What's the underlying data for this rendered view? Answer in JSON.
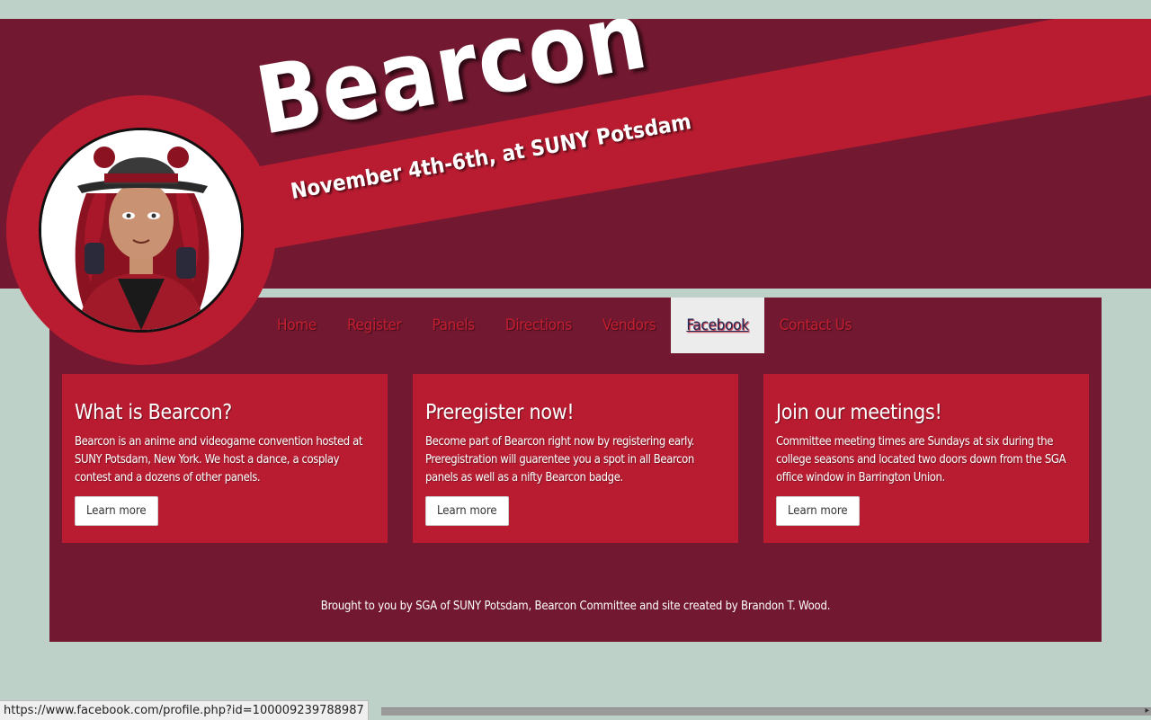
{
  "site": {
    "title": "Bearcon",
    "subtitle": "November 4th-6th, at SUNY Potsdam"
  },
  "colors": {
    "page_bg": "#bdd1c8",
    "dark_red": "#721830",
    "bright_red": "#b91c31",
    "nav_text": "#c41f30"
  },
  "nav": {
    "items": [
      {
        "label": "Home"
      },
      {
        "label": "Register"
      },
      {
        "label": "Panels"
      },
      {
        "label": "Directions"
      },
      {
        "label": "Vendors"
      },
      {
        "label": "Facebook",
        "active": true
      },
      {
        "label": "Contact Us"
      }
    ]
  },
  "cards": [
    {
      "title": "What is Bearcon?",
      "body": "Bearcon is an anime and videogame convention hosted at SUNY Potsdam, New York. We host a dance, a cosplay contest and a dozens of other panels.",
      "button": "Learn more"
    },
    {
      "title": "Preregister now!",
      "body": "Become part of Bearcon right now by registering early. Preregistration will guarentee you a spot in all Bearcon panels as well as a nifty Bearcon badge.",
      "button": "Learn more"
    },
    {
      "title": "Join our meetings!",
      "body": "Committee meeting times are Sundays at six during the college seasons and located two doors down from the SGA office window in Barrington Union.",
      "button": "Learn more"
    }
  ],
  "footer": {
    "text": "Brought to you by SGA of SUNY Potsdam, Bearcon Committee and site created by Brandon T. Wood."
  },
  "statusbar": {
    "url": "https://www.facebook.com/profile.php?id=100009239788987"
  }
}
